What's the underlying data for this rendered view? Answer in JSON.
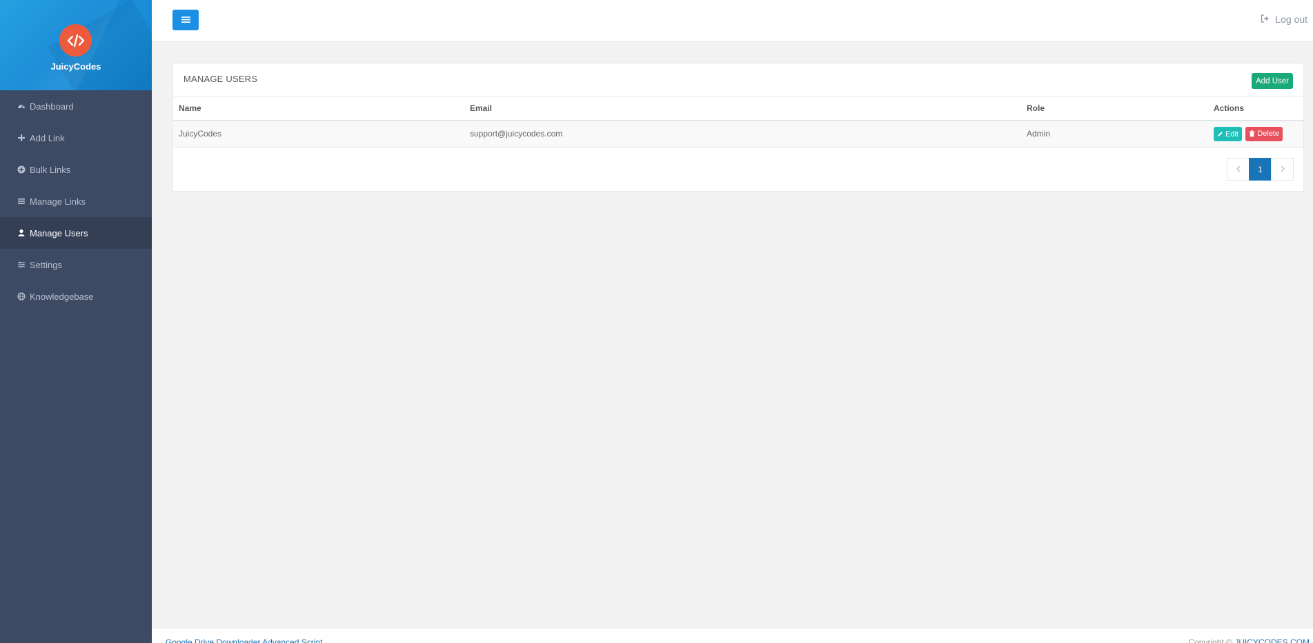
{
  "brand": {
    "name": "JuicyCodes"
  },
  "sidebar": {
    "items": [
      {
        "label": "Dashboard",
        "icon": "dashboard-icon",
        "active": false
      },
      {
        "label": "Add Link",
        "icon": "plus-icon",
        "active": false
      },
      {
        "label": "Bulk Links",
        "icon": "plus-circle-icon",
        "active": false
      },
      {
        "label": "Manage Links",
        "icon": "list-icon",
        "active": false
      },
      {
        "label": "Manage Users",
        "icon": "user-icon",
        "active": true
      },
      {
        "label": "Settings",
        "icon": "sliders-icon",
        "active": false
      },
      {
        "label": "Knowledgebase",
        "icon": "globe-icon",
        "active": false
      }
    ]
  },
  "topbar": {
    "logout_label": "Log out"
  },
  "panel": {
    "title": "MANAGE USERS",
    "add_user_label": "Add User",
    "columns": [
      "Name",
      "Email",
      "Role",
      "Actions"
    ],
    "rows": [
      {
        "name": "JuicyCodes",
        "email": "support@juicycodes.com",
        "role": "Admin",
        "edit_label": "Edit",
        "delete_label": "Delete"
      }
    ]
  },
  "pagination": {
    "prev": "‹",
    "current": "1",
    "next": "›"
  },
  "footer": {
    "left_text": "Google Drive Downloader Advanced Script",
    "copyright_prefix": "Copyright ©",
    "link_text": "JUICYCODES.COM"
  },
  "colors": {
    "accent": "#1a8fe3",
    "sidebar_bg": "#3d4a64",
    "logo": "#ee5a3c",
    "add_user": "#1aa97a",
    "edit": "#1ebfb6",
    "delete": "#e8505d"
  }
}
